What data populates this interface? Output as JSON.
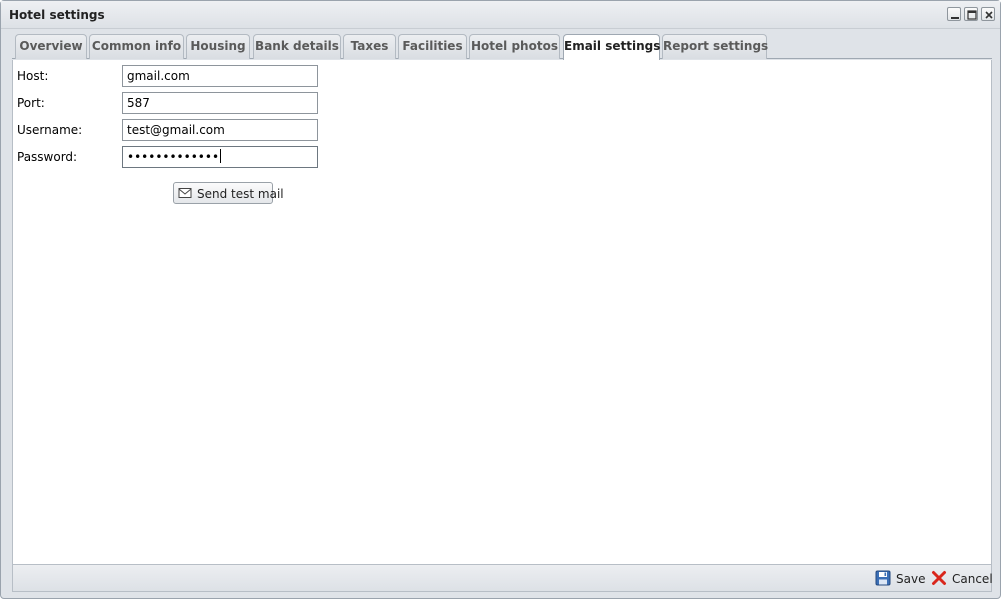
{
  "window": {
    "title": "Hotel settings",
    "minimize_icon": "minimize-icon",
    "maximize_icon": "maximize-icon",
    "close_icon": "close-icon"
  },
  "tabs": [
    {
      "label": "Overview",
      "active": false
    },
    {
      "label": "Common info",
      "active": false
    },
    {
      "label": "Housing",
      "active": false
    },
    {
      "label": "Bank details",
      "active": false
    },
    {
      "label": "Taxes",
      "active": false
    },
    {
      "label": "Facilities",
      "active": false
    },
    {
      "label": "Hotel photos",
      "active": false
    },
    {
      "label": "Email settings",
      "active": true
    },
    {
      "label": "Report settings",
      "active": false
    }
  ],
  "form": {
    "host": {
      "label": "Host:",
      "value": "gmail.com"
    },
    "port": {
      "label": "Port:",
      "value": "587"
    },
    "username": {
      "label": "Username:",
      "value": "test@gmail.com"
    },
    "password": {
      "label": "Password:",
      "value": "•••••••••••••"
    },
    "send_test_label": "Send test mail",
    "send_test_icon": "envelope-icon"
  },
  "footer": {
    "save_label": "Save",
    "save_icon": "floppy-disk-icon",
    "cancel_label": "Cancel",
    "cancel_icon": "red-x-icon"
  },
  "colors": {
    "window_bg": "#dfe3e8",
    "active_tab_bg": "#ffffff",
    "cancel_red": "#d9261c",
    "save_blue": "#3b6fb6"
  }
}
